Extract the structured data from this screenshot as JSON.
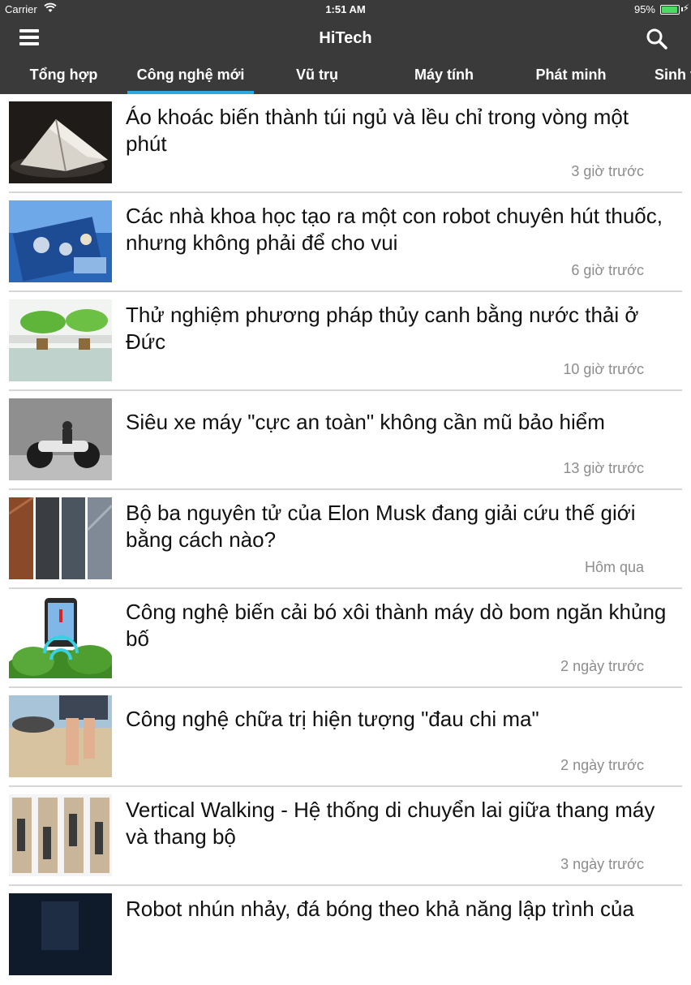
{
  "status_bar": {
    "carrier": "Carrier",
    "time": "1:51 AM",
    "battery": "95%",
    "battery_level": 0.95
  },
  "header": {
    "title": "HiTech",
    "menu_icon": "hamburger-menu-icon",
    "search_icon": "search-icon"
  },
  "tabs": [
    {
      "label": "Tổng hợp",
      "active": false
    },
    {
      "label": "Công nghệ mới",
      "active": true
    },
    {
      "label": "Vũ trụ",
      "active": false
    },
    {
      "label": "Máy tính",
      "active": false
    },
    {
      "label": "Phát minh",
      "active": false
    },
    {
      "label": "Sinh v",
      "active": false
    }
  ],
  "articles": [
    {
      "title": "Áo khoác biến thành túi ngủ và lều chỉ trong vòng một phút",
      "time": "3 giờ trước"
    },
    {
      "title": "Các nhà khoa học tạo ra một con robot chuyên hút thuốc, nhưng không phải để cho vui",
      "time": "6 giờ trước"
    },
    {
      "title": "Thử nghiệm phương pháp thủy canh bằng nước thải ở Đức",
      "time": "10 giờ trước"
    },
    {
      "title": "Siêu xe máy \"cực an toàn\" không cần mũ bảo hiểm",
      "time": "13 giờ trước"
    },
    {
      "title": "Bộ ba nguyên tử của Elon Musk đang giải cứu thế giới bằng cách nào?",
      "time": "Hôm qua"
    },
    {
      "title": "Công nghệ biến cải bó xôi thành máy dò bom ngăn khủng bố",
      "time": "2 ngày trước"
    },
    {
      "title": "Công nghệ chữa trị hiện tượng \"đau chi ma\"",
      "time": "2 ngày trước"
    },
    {
      "title": "Vertical Walking - Hệ thống di chuyển lai giữa thang máy và thang bộ",
      "time": "3 ngày trước"
    },
    {
      "title": "Robot nhún nhảy, đá bóng theo khả năng lập trình của",
      "time": ""
    }
  ],
  "colors": {
    "bar_background": "#3a3a3a",
    "tab_indicator": "#2ea8e0",
    "timestamp": "#8c8c8c"
  }
}
